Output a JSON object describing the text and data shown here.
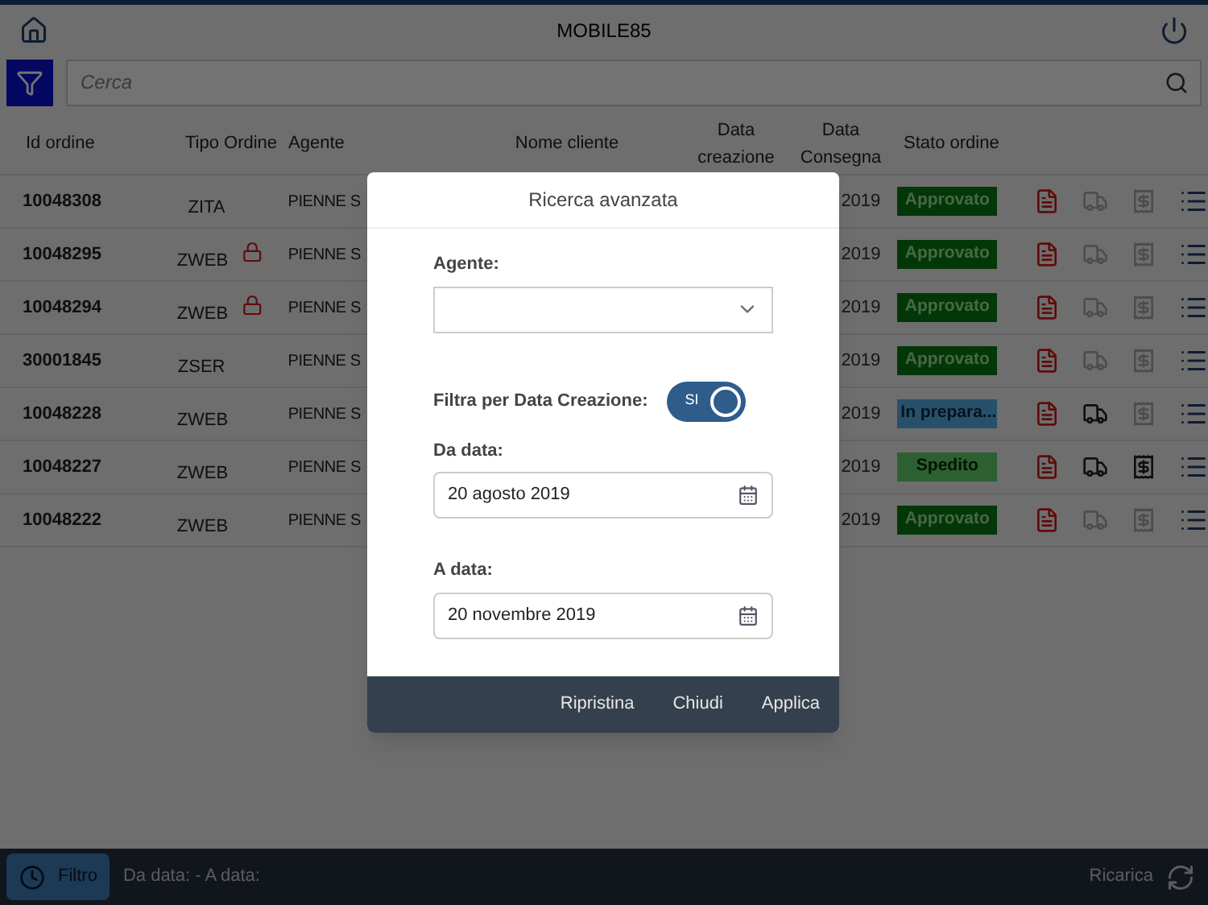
{
  "header": {
    "title": "MOBILE85"
  },
  "search": {
    "placeholder": "Cerca"
  },
  "table": {
    "columns": [
      "Id ordine",
      "Tipo Ordine",
      "Agente",
      "Nome cliente",
      "Data\ncreazione",
      "Data\nConsegna",
      "Stato ordine"
    ],
    "rows": [
      {
        "id": "10048308",
        "tipo": "ZITA",
        "locked": false,
        "agente": "PIENNE S",
        "consegna": "2019",
        "status": {
          "label": "Approvato",
          "kind": "approved"
        },
        "shipped": false,
        "document": false
      },
      {
        "id": "10048295",
        "tipo": "ZWEB",
        "locked": true,
        "agente": "PIENNE S",
        "consegna": "2019",
        "status": {
          "label": "Approvato",
          "kind": "approved"
        },
        "shipped": false,
        "document": false
      },
      {
        "id": "10048294",
        "tipo": "ZWEB",
        "locked": true,
        "agente": "PIENNE S",
        "consegna": "2019",
        "status": {
          "label": "Approvato",
          "kind": "approved"
        },
        "shipped": false,
        "document": false
      },
      {
        "id": "30001845",
        "tipo": "ZSER",
        "locked": false,
        "agente": "PIENNE S",
        "consegna": "2019",
        "status": {
          "label": "Approvato",
          "kind": "approved"
        },
        "shipped": false,
        "document": false
      },
      {
        "id": "10048228",
        "tipo": "ZWEB",
        "locked": false,
        "agente": "PIENNE S",
        "consegna": "2019",
        "status": {
          "label": "In prepara...",
          "kind": "preparing"
        },
        "shipped": true,
        "document": false
      },
      {
        "id": "10048227",
        "tipo": "ZWEB",
        "locked": false,
        "agente": "PIENNE S",
        "consegna": "2019",
        "status": {
          "label": "Spedito",
          "kind": "shipped"
        },
        "shipped": true,
        "document": true
      },
      {
        "id": "10048222",
        "tipo": "ZWEB",
        "locked": false,
        "agente": "PIENNE S",
        "consegna": "2019",
        "status": {
          "label": "Approvato",
          "kind": "approved"
        },
        "shipped": false,
        "document": false
      }
    ]
  },
  "dialog": {
    "title": "Ricerca avanzata",
    "agent_label": "Agente:",
    "filter_label": "Filtra per Data Creazione:",
    "toggle": {
      "label": "SI",
      "on": true
    },
    "from_label": "Da data:",
    "from_value": "20 agosto 2019",
    "to_label": "A data:",
    "to_value": "20 novembre 2019",
    "buttons": [
      "Ripristina",
      "Chiudi",
      "Applica"
    ]
  },
  "bottom_bar": {
    "filter_button": "Filtro",
    "filter_summary": "Da data: - A data:",
    "reload": "Ricarica"
  }
}
